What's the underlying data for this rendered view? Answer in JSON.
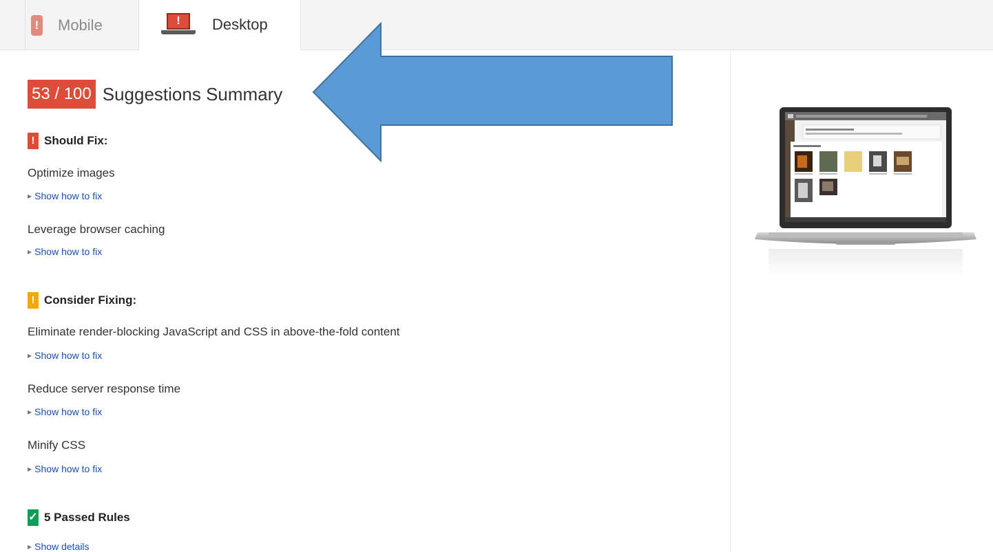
{
  "tabs": [
    {
      "label": "Mobile",
      "icon": "mobile-phone-warning-icon"
    },
    {
      "label": "Desktop",
      "icon": "laptop-warning-icon"
    }
  ],
  "summary": {
    "score": "53 / 100",
    "title": "Suggestions Summary",
    "score_color": "#dd4b39"
  },
  "should_fix": {
    "heading": "Should Fix:",
    "color": "#dd4b39",
    "items": [
      {
        "rule": "Optimize images",
        "link": "Show how to fix"
      },
      {
        "rule": "Leverage browser caching",
        "link": "Show how to fix"
      }
    ]
  },
  "consider_fixing": {
    "heading": "Consider Fixing:",
    "color": "#f4a700",
    "items": [
      {
        "rule": "Eliminate render-blocking JavaScript and CSS in above-the-fold content",
        "link": "Show how to fix"
      },
      {
        "rule": "Reduce server response time",
        "link": "Show how to fix"
      },
      {
        "rule": "Minify CSS",
        "link": "Show how to fix"
      }
    ]
  },
  "passed": {
    "heading": "5 Passed Rules",
    "link": "Show details",
    "color": "#0f9d58"
  },
  "annotation": {
    "color": "#5b9bd5",
    "icon": "left-arrow-annotation"
  }
}
